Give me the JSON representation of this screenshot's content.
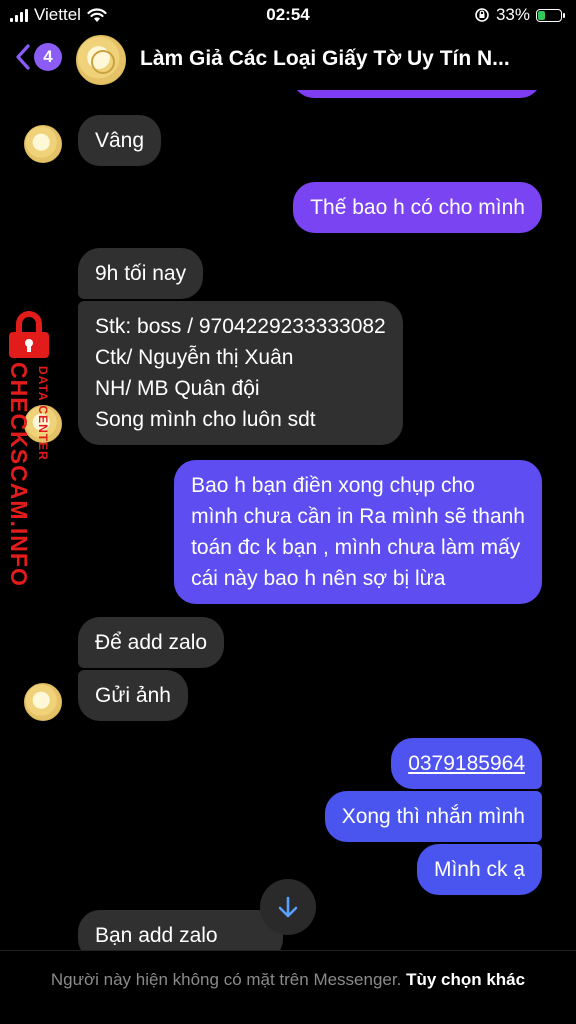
{
  "status_bar": {
    "carrier": "Viettel",
    "time": "02:54",
    "battery": "33%",
    "battery_level": 0.33
  },
  "header": {
    "unread_count": "4",
    "title": "Làm Giả Các Loại Giấy Tờ Uy Tín N..."
  },
  "colors": {
    "outgoing_top": "#9b45f5",
    "outgoing_bottom": "#4a55f0",
    "incoming": "#303030"
  },
  "watermark": {
    "line1": "CHECKSCAM.INFO",
    "line2": "DATA CENTER"
  },
  "messages": [
    {
      "dir": "in",
      "lines": [
        "Vâng"
      ]
    },
    {
      "dir": "out",
      "lines": [
        "Thế bao h có cho mình"
      ]
    },
    {
      "dir": "in",
      "lines": [
        "9h tối nay"
      ]
    },
    {
      "dir": "in",
      "lines": [
        "Stk: boss / 9704229233333082",
        "Ctk/ Nguyễn thị Xuân",
        "NH/ MB Quân đội",
        "Song mình cho luôn sdt"
      ]
    },
    {
      "dir": "out",
      "lines": [
        "Bao h bạn điền xong chụp cho",
        "mình chưa cần in Ra mình sẽ thanh",
        "toán đc k bạn , mình chưa làm mấy",
        "cái này bao h nên sợ bị lừa"
      ]
    },
    {
      "dir": "in",
      "lines": [
        "Để add zalo"
      ]
    },
    {
      "dir": "in",
      "lines": [
        "Gửi ảnh"
      ]
    },
    {
      "dir": "out",
      "lines": [
        "0379185964"
      ]
    },
    {
      "dir": "out",
      "lines": [
        "Xong thì nhắn mình"
      ]
    },
    {
      "dir": "out",
      "lines": [
        "Mình ck ạ"
      ]
    },
    {
      "dir": "in",
      "lines": [
        "Bạn add zalo"
      ]
    }
  ],
  "footer": {
    "notice": "Người này hiện không có mặt trên Messenger.",
    "options_label": "Tùy chọn khác"
  }
}
